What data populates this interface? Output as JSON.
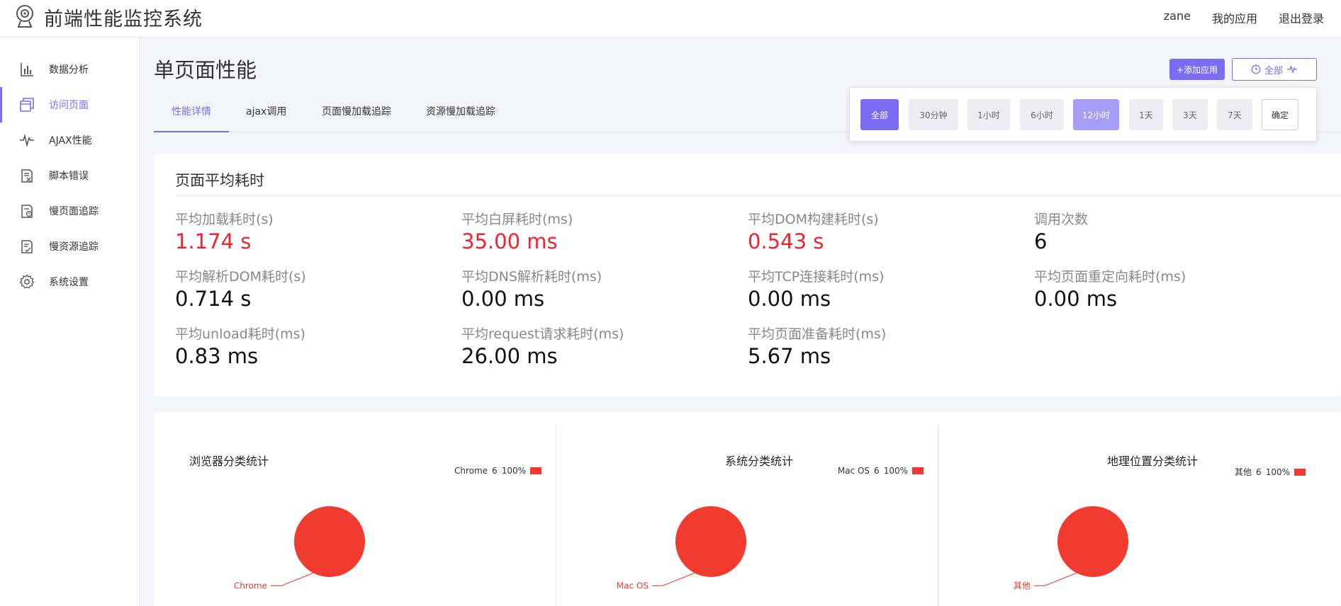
{
  "header": {
    "title": "前端性能监控系统",
    "nav": [
      "zane",
      "我的应用",
      "退出登录"
    ]
  },
  "sidebar": {
    "items": [
      {
        "label": "数据分析",
        "icon": "bar-chart-icon"
      },
      {
        "label": "访问页面",
        "icon": "pages-icon",
        "active": true
      },
      {
        "label": "AJAX性能",
        "icon": "pulse-icon"
      },
      {
        "label": "脚本错误",
        "icon": "error-script-icon"
      },
      {
        "label": "慢页面追踪",
        "icon": "slow-page-icon"
      },
      {
        "label": "慢资源追踪",
        "icon": "slow-resource-icon"
      },
      {
        "label": "系统设置",
        "icon": "gear-icon"
      }
    ]
  },
  "main": {
    "title": "单页面性能",
    "tabs": [
      "性能详情",
      "ajax调用",
      "页面慢加载追踪",
      "资源慢加载追踪"
    ],
    "active_tab": "性能详情",
    "add_app_label": "+添加应用",
    "range_button_label": "全部",
    "range_options": [
      "全部",
      "30分钟",
      "1小时",
      "6小时",
      "12小时",
      "1天",
      "3天",
      "7天"
    ],
    "range_selected": "12小时",
    "range_confirm": "确定"
  },
  "stats": {
    "title": "页面平均耗时",
    "items": [
      {
        "label": "平均加载耗时(s)",
        "value": "1.174 s",
        "highlight": true
      },
      {
        "label": "平均白屏耗时(ms)",
        "value": "35.00 ms",
        "highlight": true
      },
      {
        "label": "平均DOM构建耗时(s)",
        "value": "0.543 s",
        "highlight": true
      },
      {
        "label": "调用次数",
        "value": "6",
        "highlight": false
      },
      {
        "label": "平均解析DOM耗时(s)",
        "value": "0.714 s",
        "highlight": false
      },
      {
        "label": "平均DNS解析耗时(ms)",
        "value": "0.00 ms",
        "highlight": false
      },
      {
        "label": "平均TCP连接耗时(ms)",
        "value": "0.00 ms",
        "highlight": false
      },
      {
        "label": "平均页面重定向耗时(ms)",
        "value": "0.00 ms",
        "highlight": false
      },
      {
        "label": "平均unload耗时(ms)",
        "value": "0.83 ms",
        "highlight": false
      },
      {
        "label": "平均request请求耗时(ms)",
        "value": "26.00 ms",
        "highlight": false
      },
      {
        "label": "平均页面准备耗时(ms)",
        "value": "5.67 ms",
        "highlight": false
      }
    ]
  },
  "colors": {
    "accent": "#7c6cf2",
    "danger": "#f5222d",
    "pie": "#f13a30"
  },
  "chart_data": [
    {
      "type": "pie",
      "title": "浏览器分类统计",
      "categories": [
        "Chrome"
      ],
      "values": [
        6
      ],
      "percent": [
        "100%"
      ],
      "legend": "top-right"
    },
    {
      "type": "pie",
      "title": "系统分类统计",
      "categories": [
        "Mac OS"
      ],
      "values": [
        6
      ],
      "percent": [
        "100%"
      ],
      "legend": "top-right"
    },
    {
      "type": "pie",
      "title": "地理位置分类统计",
      "categories": [
        "其他"
      ],
      "values": [
        6
      ],
      "percent": [
        "100%"
      ],
      "legend": "top-right"
    }
  ]
}
